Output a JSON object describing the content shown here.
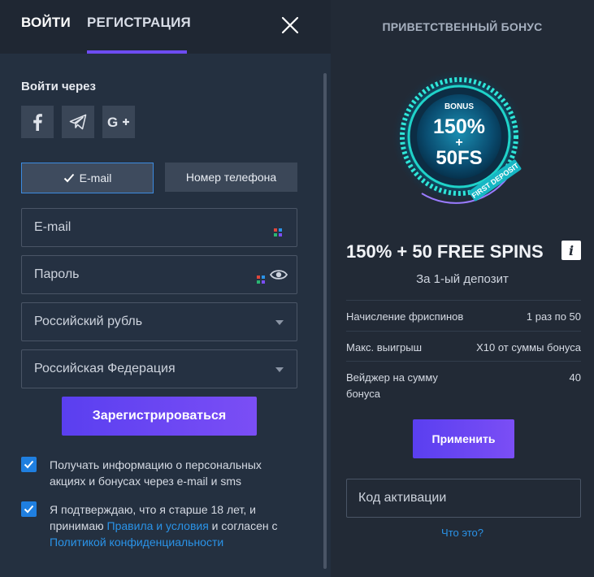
{
  "tabs": {
    "login": "ВОЙТИ",
    "register": "РЕГИСТРАЦИЯ"
  },
  "login_via": {
    "title": "Войти через",
    "providers": [
      "facebook-icon",
      "telegram-icon",
      "google-plus-icon"
    ]
  },
  "method": {
    "email_label": "E-mail",
    "phone_label": "Номер телефона",
    "selected": "email"
  },
  "form": {
    "email_placeholder": "E-mail",
    "password_placeholder": "Пароль",
    "currency": "Российский рубль",
    "country": "Российская Федерация",
    "submit": "Зарегистрироваться"
  },
  "consents": {
    "marketing": "Получать информацию о персональных акциях и бонусах через e-mail и sms",
    "age_prefix": "Я подтверждаю, что я старше 18 лет, и принимаю ",
    "terms_link": "Правила и условия",
    "age_middle": " и согласен с ",
    "privacy_link": "Политикой конфиденциальности",
    "marketing_checked": true,
    "age_checked": true
  },
  "bonus": {
    "title": "ПРИВЕТСТВЕННЫЙ БОНУС",
    "badge_top": "BONUS",
    "badge_main": "150%",
    "badge_plus": "+",
    "badge_fs": "50FS",
    "badge_ring": "FIRST DEPOSIT",
    "headline": "150% + 50 FREE SPINS",
    "subtitle": "За 1-ый депозит",
    "details": [
      {
        "label": "Начисление фриспинов",
        "value": "1 раз по 50"
      },
      {
        "label": "Макс. выигрыш",
        "value": "X10 от суммы бонуса"
      },
      {
        "label": "Вейджер на сумму бонуса",
        "value": "40"
      }
    ],
    "apply": "Применить",
    "code_placeholder": "Код активации",
    "what_is_it": "Что это?"
  },
  "colors": {
    "accent": "#6d4cf2",
    "link": "#2a93e8",
    "checkbox": "#1f7fe0",
    "badge_glow": "#1fd3c9"
  }
}
